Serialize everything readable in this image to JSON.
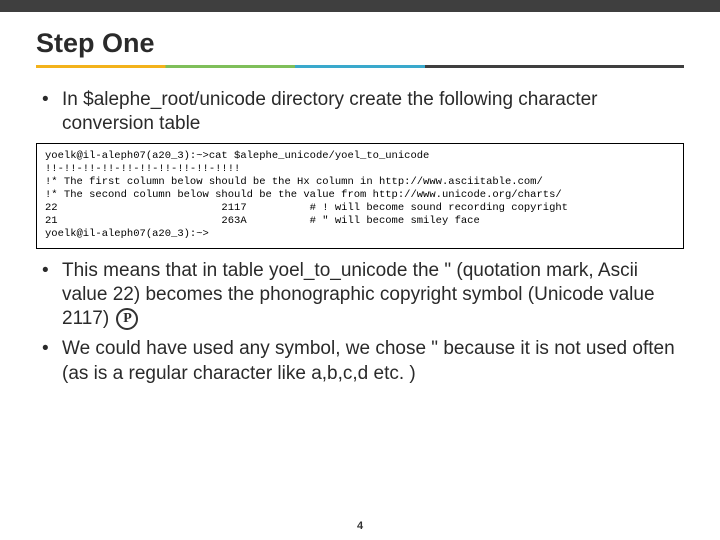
{
  "title": "Step One",
  "bullets": {
    "b1": "In $alephe_root/unicode directory create the following character conversion table",
    "b2_pre": "This means that in table yoel_to_unicode the \" (quotation mark, Ascii value 22) becomes the phonographic copyright symbol (Unicode value 2117) ",
    "b3": "We could have used any symbol, we chose \" because it is not used often (as is a regular character like a,b,c,d etc. )"
  },
  "code": {
    "l1": "yoelk@il-aleph07(a20_3):~>cat $alephe_unicode/yoel_to_unicode",
    "l2": "!!-!!-!!-!!-!!-!!-!!-!!-!!-!!!!",
    "l3": "!* The first column below should be the Hx column in http://www.asciitable.com/",
    "l4": "!* The second column below should be the value from http://www.unicode.org/charts/",
    "l5": "22                          2117          # ! will become sound recording copyright",
    "l6": "21                          263A          # \" will become smiley face",
    "l7": "yoelk@il-aleph07(a20_3):~>"
  },
  "icon": "P",
  "page_number": "4"
}
